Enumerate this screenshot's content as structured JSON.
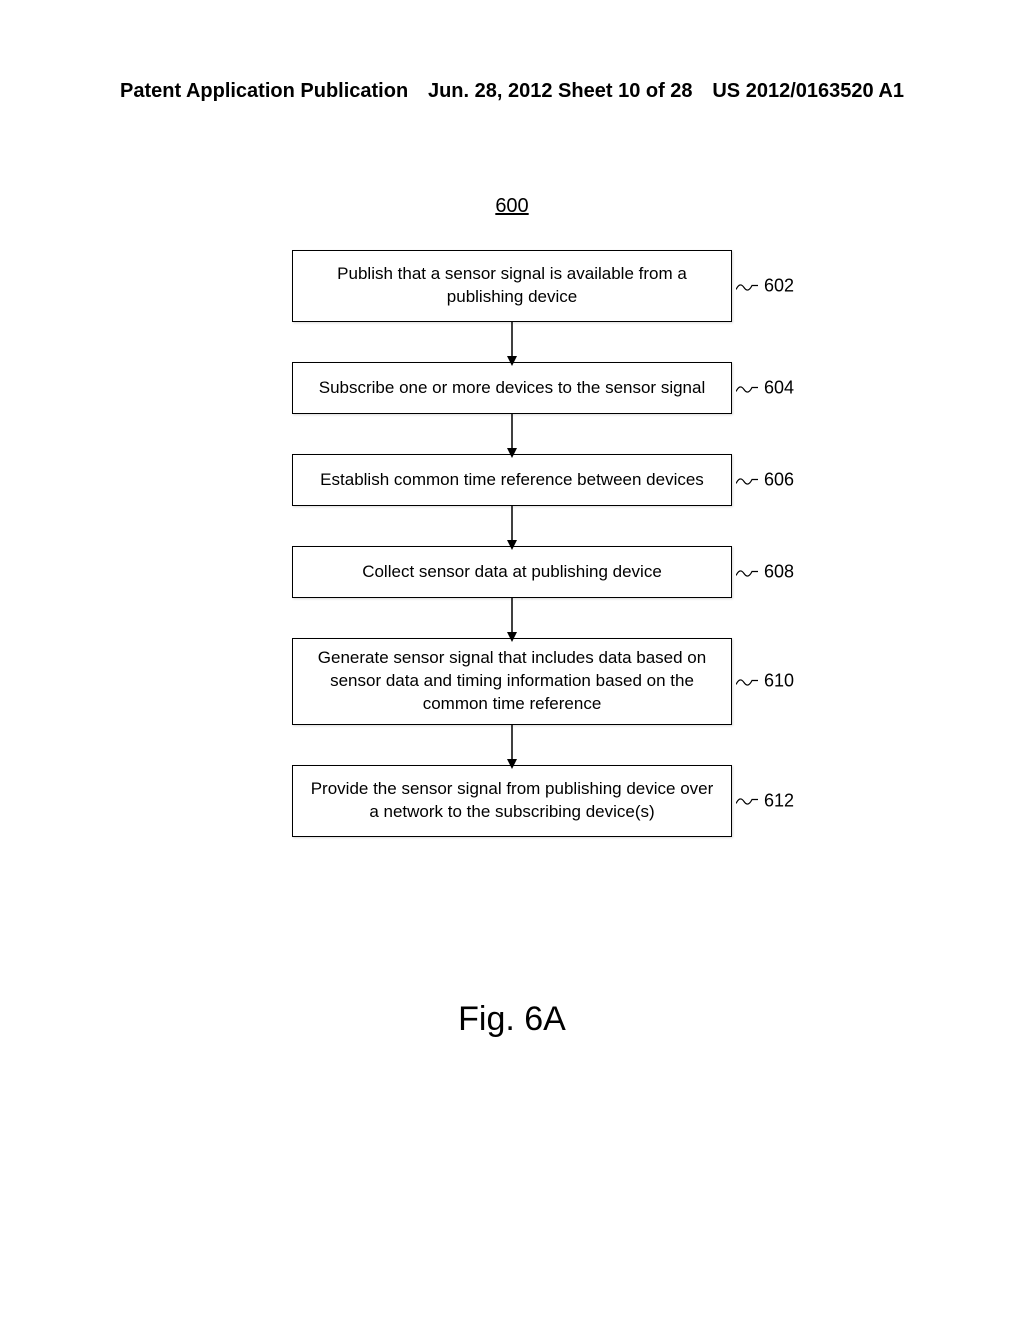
{
  "header": {
    "left": "Patent Application Publication",
    "center": "Jun. 28, 2012  Sheet 10 of 28",
    "right": "US 2012/0163520 A1"
  },
  "figure_number": "600",
  "steps": [
    {
      "text": "Publish that a sensor signal is available from a publishing device",
      "label": "602",
      "tall": true
    },
    {
      "text": "Subscribe one or more devices to the sensor signal",
      "label": "604",
      "tall": false
    },
    {
      "text": "Establish common time reference between devices",
      "label": "606",
      "tall": false
    },
    {
      "text": "Collect sensor data at publishing device",
      "label": "608",
      "tall": false
    },
    {
      "text": "Generate sensor signal that includes data based on sensor data and timing information based on the common time reference",
      "label": "610",
      "tall": true
    },
    {
      "text": "Provide the sensor signal from publishing device over a network to the subscribing device(s)",
      "label": "612",
      "tall": true
    }
  ],
  "figure_caption": "Fig. 6A"
}
